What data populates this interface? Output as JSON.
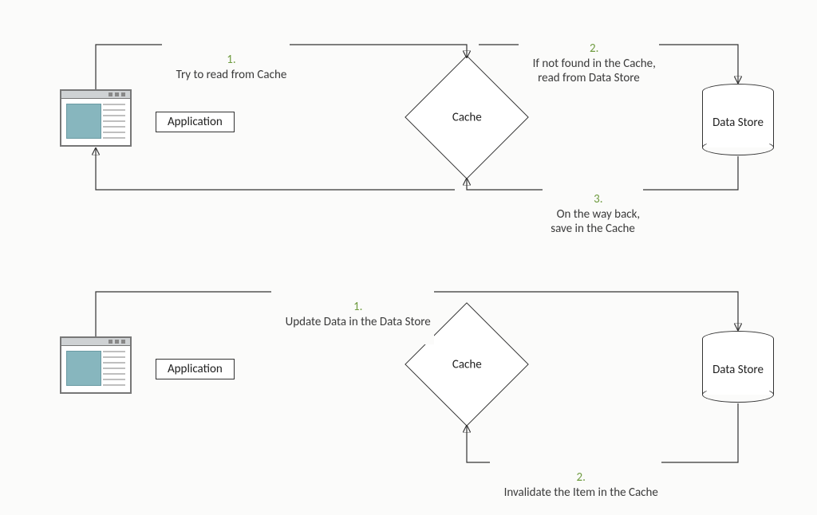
{
  "diagram": {
    "top": {
      "application_label": "Application",
      "cache_label": "Cache",
      "datastore_label": "Data Store",
      "step1_num": "1.",
      "step1_text": "Try to read from Cache",
      "step2_num": "2.",
      "step2_text": "If not found in the Cache,\nread from Data Store",
      "step3_num": "3.",
      "step3_text": "On the way back,\nsave in the Cache"
    },
    "bottom": {
      "application_label": "Application",
      "cache_label": "Cache",
      "datastore_label": "Data Store",
      "step1_num": "1.",
      "step1_text": "Update Data in the Data Store",
      "step2_num": "2.",
      "step2_text": "Invalidate the Item in the Cache"
    }
  }
}
